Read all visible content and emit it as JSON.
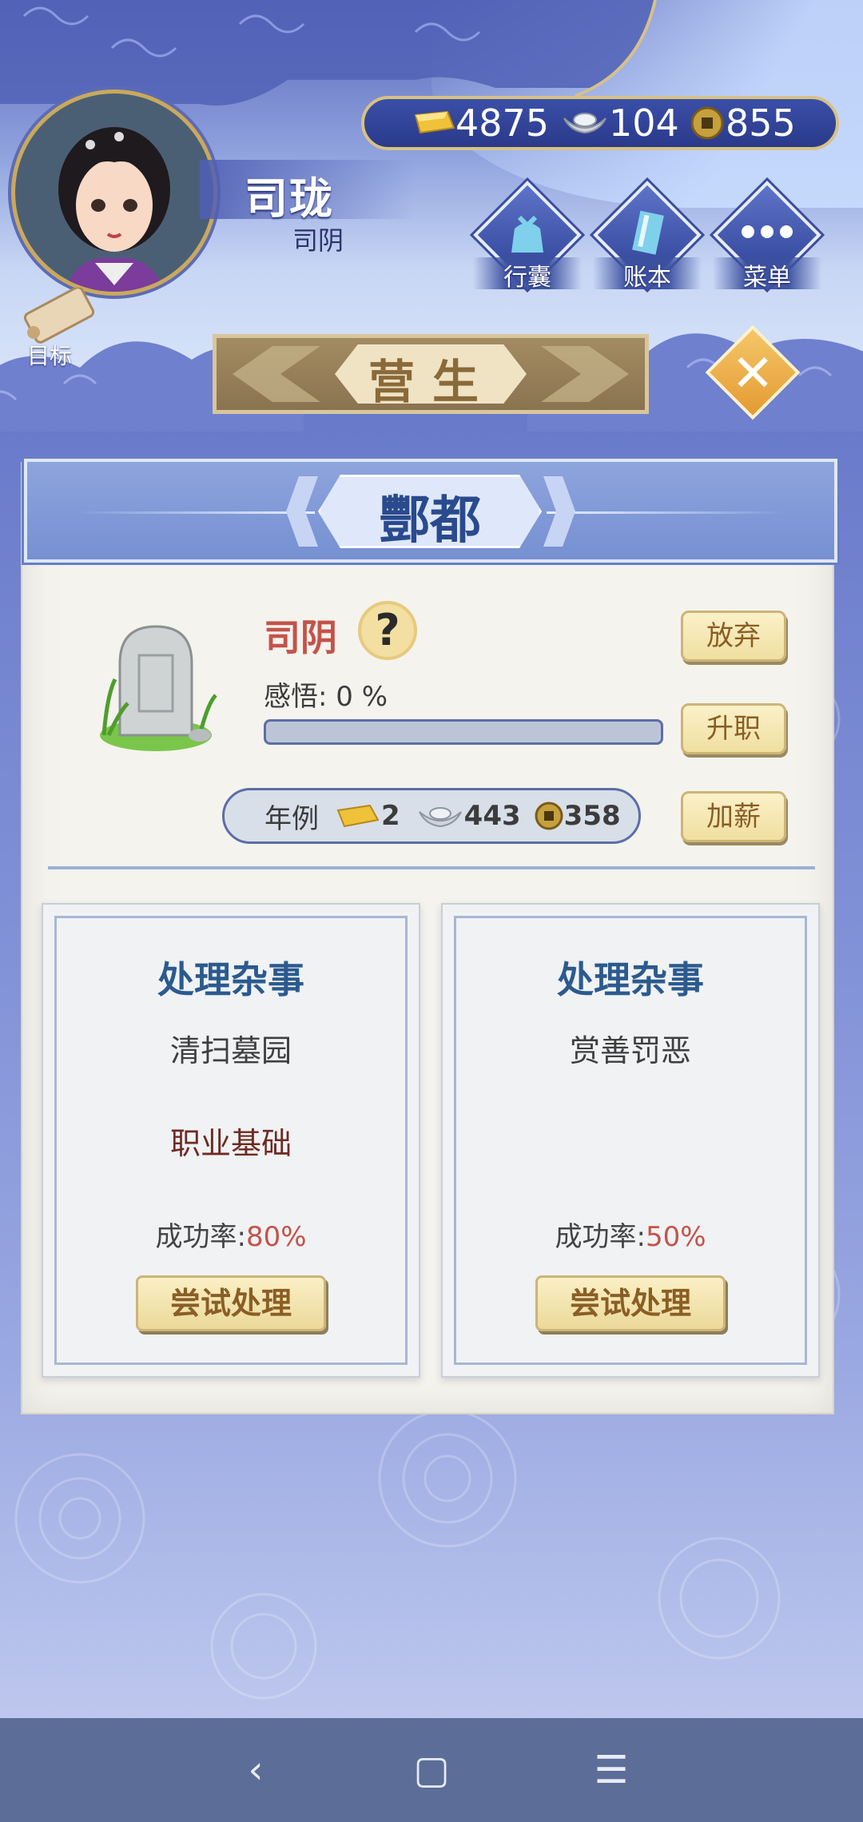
{
  "player": {
    "name": "司珑",
    "title": "司阴"
  },
  "currency": {
    "gold": "4875",
    "silver": "104",
    "coin": "855"
  },
  "top_buttons": {
    "bag": "行囊",
    "ledger": "账本",
    "menu": "菜单"
  },
  "goal": {
    "label": "目标"
  },
  "screen": {
    "title": "营生"
  },
  "location": {
    "name": "酆都"
  },
  "job": {
    "name": "司阴",
    "insight_label": "感悟:",
    "insight_value": "0 %",
    "insight_progress": 0,
    "buttons": {
      "abandon": "放弃",
      "promote": "升职",
      "raise": "加薪"
    }
  },
  "salary": {
    "label": "年例",
    "gold": "2",
    "silver": "443",
    "coin": "358"
  },
  "tasks": [
    {
      "title": "处理杂事",
      "subtitle": "清扫墓园",
      "requirement": "职业基础",
      "rate_label": "成功率:",
      "rate": "80%",
      "button": "尝试处理"
    },
    {
      "title": "处理杂事",
      "subtitle": "赏善罚恶",
      "requirement": "",
      "rate_label": "成功率:",
      "rate": "50%",
      "button": "尝试处理"
    }
  ],
  "colors": {
    "rate": "#c4534a",
    "job_name": "#c4534a",
    "location": "#2a4a8e",
    "task_title": "#2b5a8e"
  },
  "icons": {
    "nav_back": "back-icon",
    "nav_home": "home-icon",
    "nav_menu": "menu-icon"
  }
}
